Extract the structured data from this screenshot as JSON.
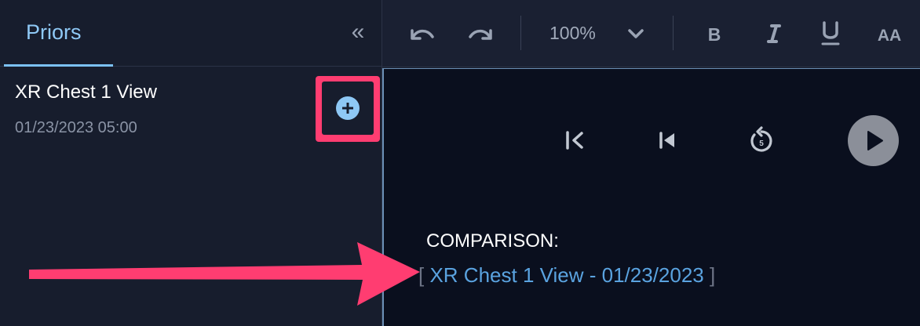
{
  "sidebar": {
    "tab_label": "Priors",
    "collapse_glyph": "«",
    "prior": {
      "title": "XR Chest 1 View",
      "date": "01/23/2023 05:00"
    }
  },
  "toolbar": {
    "zoom": "100%"
  },
  "editor": {
    "comparison_label": "COMPARISON:",
    "comparison_value": "XR Chest 1 View - 01/23/2023",
    "bracket_open": "[",
    "bracket_close": "]"
  },
  "colors": {
    "accent": "#8ec8f5",
    "link": "#5aa3e0",
    "highlight": "#ff3d71",
    "panel_bg": "#171d2d",
    "editor_bg": "#0a0f1e"
  },
  "icons": [
    "chevrons-left-icon",
    "undo-icon",
    "redo-icon",
    "chevron-down-icon",
    "bold-icon",
    "italic-icon",
    "underline-icon",
    "text-size-icon",
    "skip-start-icon",
    "step-back-icon",
    "replay-5-icon",
    "play-icon",
    "plus-circle-icon",
    "annotation-arrow"
  ]
}
